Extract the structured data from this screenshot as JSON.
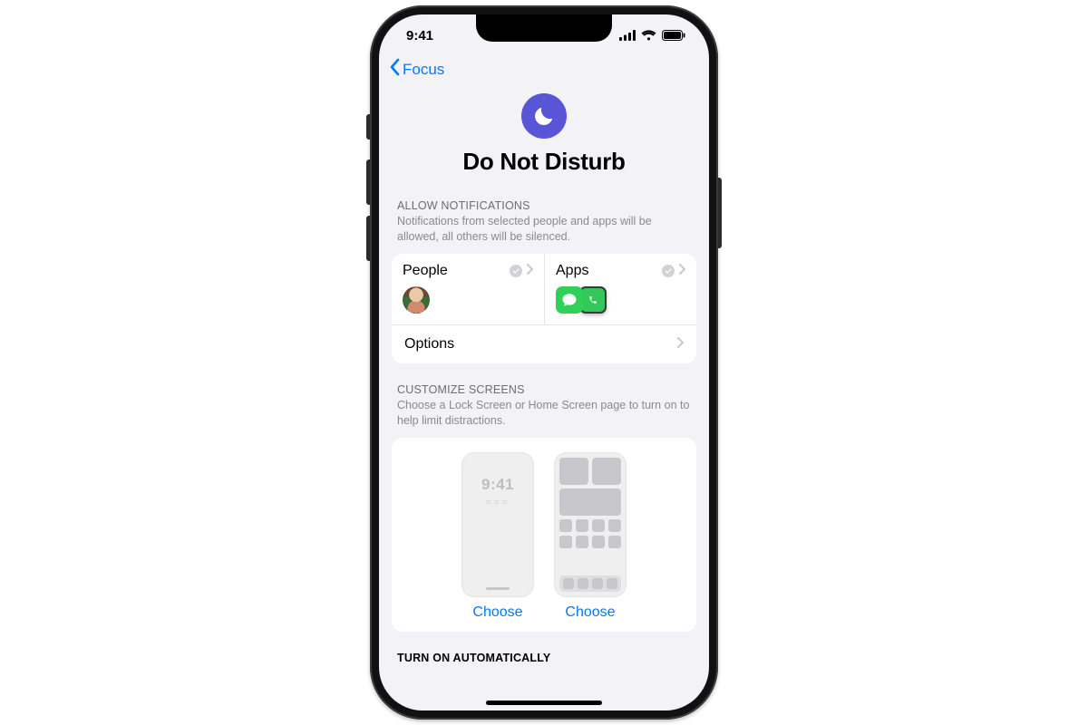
{
  "status": {
    "time": "9:41"
  },
  "nav": {
    "back_label": "Focus"
  },
  "hero": {
    "title": "Do Not Disturb"
  },
  "allow": {
    "header": "ALLOW NOTIFICATIONS",
    "sub": "Notifications from selected people and apps will be allowed, all others will be silenced.",
    "people_label": "People",
    "apps_label": "Apps",
    "options_label": "Options"
  },
  "customize": {
    "header": "CUSTOMIZE SCREENS",
    "sub": "Choose a Lock Screen or Home Screen page to turn on to help limit distractions.",
    "lock_time": "9:41",
    "choose_label": "Choose"
  },
  "auto": {
    "header": "TURN ON AUTOMATICALLY"
  }
}
